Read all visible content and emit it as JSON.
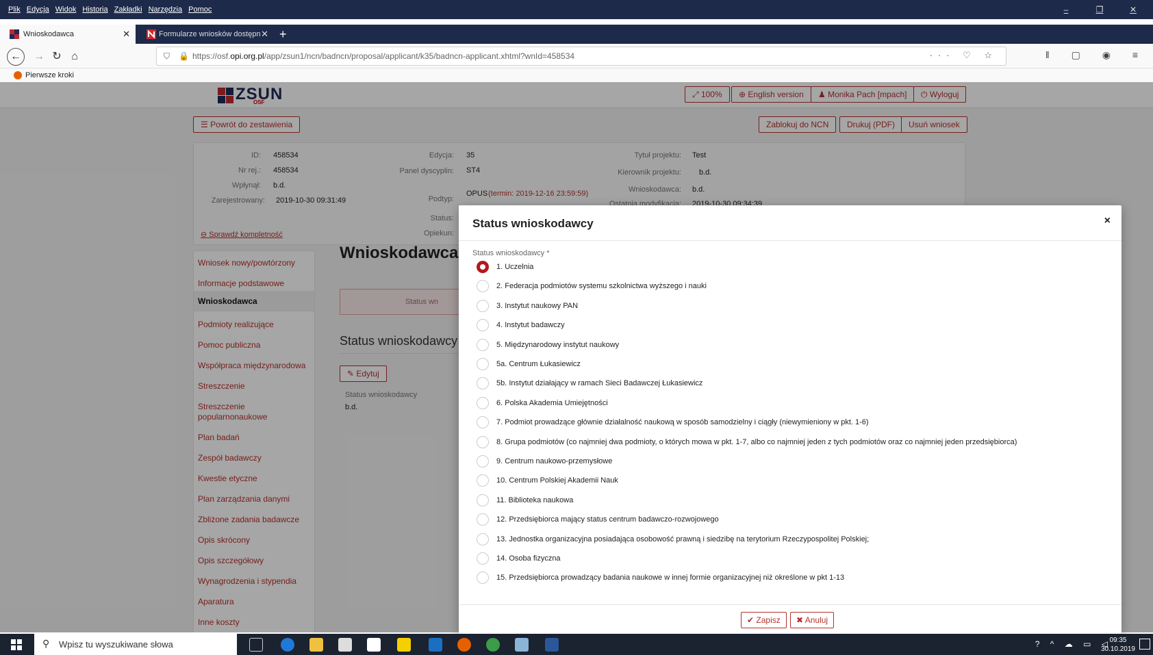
{
  "menubar": [
    "Plik",
    "Edycja",
    "Widok",
    "Historia",
    "Zakładki",
    "Narzędzia",
    "Pomoc"
  ],
  "tabs": [
    {
      "title": "Wnioskodawca"
    },
    {
      "title": "Formularze wniosków dostępn"
    }
  ],
  "url": {
    "prefix": "https://osf.",
    "domain": "opi.org.pl",
    "path": "/app/zsun1/ncn/badncn/proposal/applicant/k35/badncn-applicant.xhtml?wnId=458534"
  },
  "bookmark": "Pierwsze kroki",
  "header": {
    "logo": "ZSUN",
    "logo_sub": "OSF",
    "zoom": "100%",
    "english": "English version",
    "user": "Monika Pach [mpach]",
    "logout": "Wyloguj"
  },
  "actions": {
    "back": "Powrót do zestawienia",
    "lock": "Zablokuj do NCN",
    "print": "Drukuj (PDF)",
    "delete": "Usuń wniosek"
  },
  "info": {
    "id_label": "ID:",
    "id": "458534",
    "nrrej_label": "Nr rej.:",
    "nrrej": "458534",
    "wplynal_label": "Wpłynął:",
    "wplynal": "b.d.",
    "zarej_label": "Zarejestrowany:",
    "zarej": "2019-10-30 09:31:49",
    "edycja_label": "Edycja:",
    "edycja": "35",
    "panel_label": "Panel dyscyplin:",
    "panel": "ST4",
    "podtyp_label": "Podtyp:",
    "podtyp": "OPUS",
    "termin": "(termin: 2019-12-16 23:59:59)",
    "status_label": "Status:",
    "opiekun_label": "Opiekun:",
    "tytul_label": "Tytuł projektu:",
    "tytul": "Test",
    "kierownik_label": "Kierownik projektu:",
    "kierownik": "b.d.",
    "wnioskodawca_label": "Wnioskodawca:",
    "wnioskodawca": "b.d.",
    "modyf_label": "Ostatnia modyfikacja:",
    "modyf": "2019-10-30 09:34:39",
    "check": "Sprawdź kompletność"
  },
  "sidenav": [
    "Wniosek nowy/powtórzony",
    "Informacje podstawowe",
    "Wnioskodawca",
    "Podmioty realizujące",
    "Pomoc publiczna",
    "Współpraca międzynarodowa",
    "Streszczenie",
    "Streszczenie popularnonaukowe",
    "Plan badań",
    "Zespół badawczy",
    "Kwestie etyczne",
    "Plan zarządzania danymi",
    "Zbliżone zadania badawcze",
    "Opis skrócony",
    "Opis szczegółowy",
    "Wynagrodzenia i stypendia",
    "Aparatura",
    "Inne koszty"
  ],
  "content": {
    "heading": "Wnioskodawca",
    "alert": "Status wn",
    "section": "Status wnioskodawcy",
    "edit": "Edytuj",
    "field_label": "Status wnioskodawcy",
    "field_value": "b.d."
  },
  "modal": {
    "title": "Status wnioskodawcy",
    "close": "×",
    "label": "Status wnioskodawcy *",
    "selected_index": 0,
    "options": [
      "1. Uczelnia",
      "2. Federacja podmiotów systemu szkolnictwa wyższego i nauki",
      "3. Instytut naukowy PAN",
      "4. Instytut badawczy",
      "5. Międzynarodowy instytut naukowy",
      "5a. Centrum Łukasiewicz",
      "5b. Instytut działający w ramach Sieci Badawczej Łukasiewicz",
      "6. Polska Akademia Umiejętności",
      "7. Podmiot prowadzące głównie działalność naukową w sposób samodzielny i ciągły (niewymieniony w pkt. 1-6)",
      "8. Grupa podmiotów (co najmniej dwa podmioty, o których mowa w pkt. 1-7, albo co najmniej jeden z tych podmiotów oraz co najmniej jeden przedsiębiorca)",
      "9. Centrum naukowo-przemysłowe",
      "10. Centrum Polskiej Akademii Nauk",
      "11. Biblioteka naukowa",
      "12. Przedsiębiorca mający status centrum badawczo-rozwojowego",
      "13. Jednostka organizacyjna posiadająca osobowość prawną i siedzibę na terytorium Rzeczypospolitej Polskiej;",
      "14. Osoba fizyczna",
      "15. Przedsiębiorca prowadzący badania naukowe w innej formie organizacyjnej niż określone w pkt 1-13"
    ],
    "save": "Zapisz",
    "cancel": "Anuluj"
  },
  "taskbar": {
    "search_placeholder": "Wpisz tu wyszukiwane słowa",
    "time": "09:35",
    "date": "30.10.2019"
  }
}
